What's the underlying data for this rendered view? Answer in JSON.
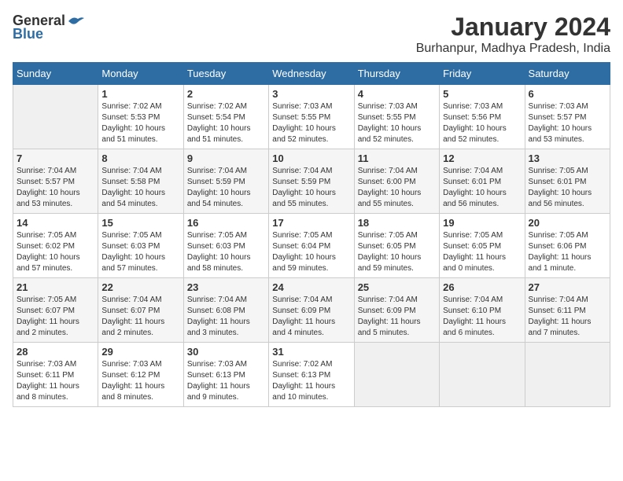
{
  "logo": {
    "general": "General",
    "blue": "Blue"
  },
  "header": {
    "title": "January 2024",
    "subtitle": "Burhanpur, Madhya Pradesh, India"
  },
  "days_of_week": [
    "Sunday",
    "Monday",
    "Tuesday",
    "Wednesday",
    "Thursday",
    "Friday",
    "Saturday"
  ],
  "weeks": [
    [
      {
        "day": "",
        "info": ""
      },
      {
        "day": "1",
        "info": "Sunrise: 7:02 AM\nSunset: 5:53 PM\nDaylight: 10 hours\nand 51 minutes."
      },
      {
        "day": "2",
        "info": "Sunrise: 7:02 AM\nSunset: 5:54 PM\nDaylight: 10 hours\nand 51 minutes."
      },
      {
        "day": "3",
        "info": "Sunrise: 7:03 AM\nSunset: 5:55 PM\nDaylight: 10 hours\nand 52 minutes."
      },
      {
        "day": "4",
        "info": "Sunrise: 7:03 AM\nSunset: 5:55 PM\nDaylight: 10 hours\nand 52 minutes."
      },
      {
        "day": "5",
        "info": "Sunrise: 7:03 AM\nSunset: 5:56 PM\nDaylight: 10 hours\nand 52 minutes."
      },
      {
        "day": "6",
        "info": "Sunrise: 7:03 AM\nSunset: 5:57 PM\nDaylight: 10 hours\nand 53 minutes."
      }
    ],
    [
      {
        "day": "7",
        "info": "Sunrise: 7:04 AM\nSunset: 5:57 PM\nDaylight: 10 hours\nand 53 minutes."
      },
      {
        "day": "8",
        "info": "Sunrise: 7:04 AM\nSunset: 5:58 PM\nDaylight: 10 hours\nand 54 minutes."
      },
      {
        "day": "9",
        "info": "Sunrise: 7:04 AM\nSunset: 5:59 PM\nDaylight: 10 hours\nand 54 minutes."
      },
      {
        "day": "10",
        "info": "Sunrise: 7:04 AM\nSunset: 5:59 PM\nDaylight: 10 hours\nand 55 minutes."
      },
      {
        "day": "11",
        "info": "Sunrise: 7:04 AM\nSunset: 6:00 PM\nDaylight: 10 hours\nand 55 minutes."
      },
      {
        "day": "12",
        "info": "Sunrise: 7:04 AM\nSunset: 6:01 PM\nDaylight: 10 hours\nand 56 minutes."
      },
      {
        "day": "13",
        "info": "Sunrise: 7:05 AM\nSunset: 6:01 PM\nDaylight: 10 hours\nand 56 minutes."
      }
    ],
    [
      {
        "day": "14",
        "info": "Sunrise: 7:05 AM\nSunset: 6:02 PM\nDaylight: 10 hours\nand 57 minutes."
      },
      {
        "day": "15",
        "info": "Sunrise: 7:05 AM\nSunset: 6:03 PM\nDaylight: 10 hours\nand 57 minutes."
      },
      {
        "day": "16",
        "info": "Sunrise: 7:05 AM\nSunset: 6:03 PM\nDaylight: 10 hours\nand 58 minutes."
      },
      {
        "day": "17",
        "info": "Sunrise: 7:05 AM\nSunset: 6:04 PM\nDaylight: 10 hours\nand 59 minutes."
      },
      {
        "day": "18",
        "info": "Sunrise: 7:05 AM\nSunset: 6:05 PM\nDaylight: 10 hours\nand 59 minutes."
      },
      {
        "day": "19",
        "info": "Sunrise: 7:05 AM\nSunset: 6:05 PM\nDaylight: 11 hours\nand 0 minutes."
      },
      {
        "day": "20",
        "info": "Sunrise: 7:05 AM\nSunset: 6:06 PM\nDaylight: 11 hours\nand 1 minute."
      }
    ],
    [
      {
        "day": "21",
        "info": "Sunrise: 7:05 AM\nSunset: 6:07 PM\nDaylight: 11 hours\nand 2 minutes."
      },
      {
        "day": "22",
        "info": "Sunrise: 7:04 AM\nSunset: 6:07 PM\nDaylight: 11 hours\nand 2 minutes."
      },
      {
        "day": "23",
        "info": "Sunrise: 7:04 AM\nSunset: 6:08 PM\nDaylight: 11 hours\nand 3 minutes."
      },
      {
        "day": "24",
        "info": "Sunrise: 7:04 AM\nSunset: 6:09 PM\nDaylight: 11 hours\nand 4 minutes."
      },
      {
        "day": "25",
        "info": "Sunrise: 7:04 AM\nSunset: 6:09 PM\nDaylight: 11 hours\nand 5 minutes."
      },
      {
        "day": "26",
        "info": "Sunrise: 7:04 AM\nSunset: 6:10 PM\nDaylight: 11 hours\nand 6 minutes."
      },
      {
        "day": "27",
        "info": "Sunrise: 7:04 AM\nSunset: 6:11 PM\nDaylight: 11 hours\nand 7 minutes."
      }
    ],
    [
      {
        "day": "28",
        "info": "Sunrise: 7:03 AM\nSunset: 6:11 PM\nDaylight: 11 hours\nand 8 minutes."
      },
      {
        "day": "29",
        "info": "Sunrise: 7:03 AM\nSunset: 6:12 PM\nDaylight: 11 hours\nand 8 minutes."
      },
      {
        "day": "30",
        "info": "Sunrise: 7:03 AM\nSunset: 6:13 PM\nDaylight: 11 hours\nand 9 minutes."
      },
      {
        "day": "31",
        "info": "Sunrise: 7:02 AM\nSunset: 6:13 PM\nDaylight: 11 hours\nand 10 minutes."
      },
      {
        "day": "",
        "info": ""
      },
      {
        "day": "",
        "info": ""
      },
      {
        "day": "",
        "info": ""
      }
    ]
  ]
}
